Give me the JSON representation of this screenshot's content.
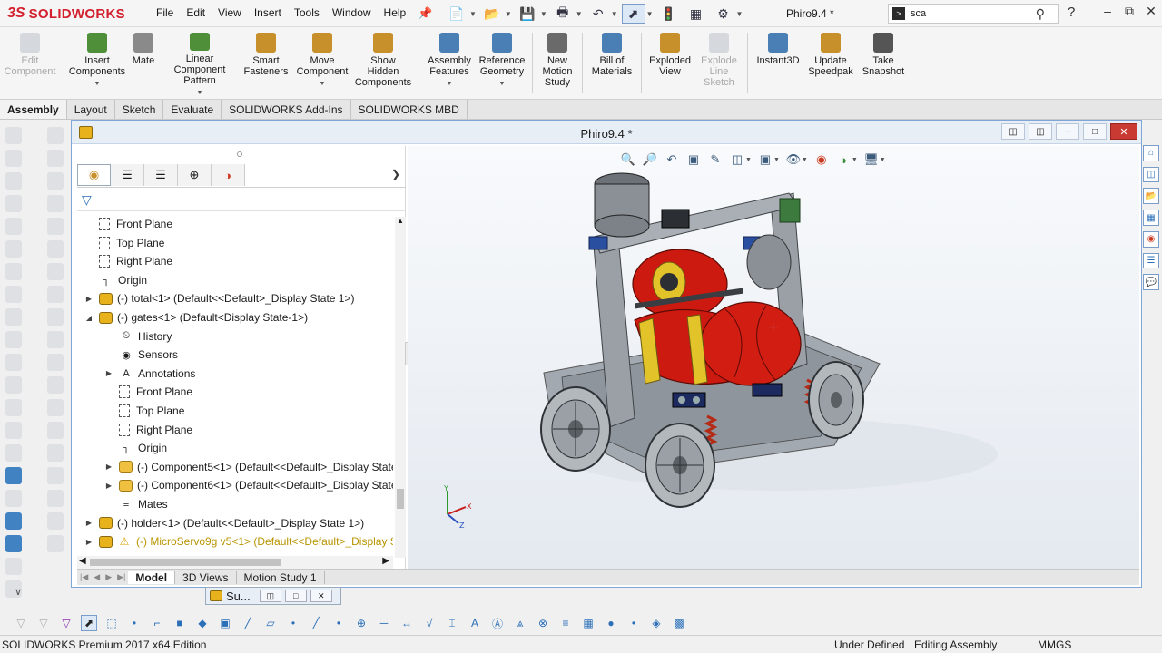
{
  "app": {
    "logo_text": "SOLIDWORKS",
    "logo_mark": "3S"
  },
  "menu": [
    "File",
    "Edit",
    "View",
    "Insert",
    "Tools",
    "Window",
    "Help"
  ],
  "title_bar": {
    "document_title": "Phiro9.4 *"
  },
  "search": {
    "value": "sca"
  },
  "ribbon": [
    {
      "label": "Edit Component",
      "lines": [
        "Edit",
        "Component"
      ],
      "enabled": false,
      "icon": "edit-component-icon",
      "color": "#9aa7b4"
    },
    {
      "label": "Insert Components",
      "lines": [
        "Insert",
        "Components"
      ],
      "enabled": true,
      "dropdown": true,
      "icon": "insert-components-icon",
      "color": "#4f8f3a"
    },
    {
      "label": "Mate",
      "lines": [
        "Mate"
      ],
      "enabled": true,
      "icon": "mate-icon",
      "color": "#8a8a8a"
    },
    {
      "label": "Linear Component Pattern",
      "lines": [
        "Linear Component",
        "Pattern"
      ],
      "enabled": true,
      "dropdown": true,
      "icon": "linear-pattern-icon",
      "color": "#4f8f3a"
    },
    {
      "label": "Smart Fasteners",
      "lines": [
        "Smart",
        "Fasteners"
      ],
      "enabled": true,
      "icon": "smart-fasteners-icon",
      "color": "#c7902a"
    },
    {
      "label": "Move Component",
      "lines": [
        "Move",
        "Component"
      ],
      "enabled": true,
      "dropdown": true,
      "icon": "move-component-icon",
      "color": "#c7902a"
    },
    {
      "label": "Show Hidden Components",
      "lines": [
        "Show",
        "Hidden",
        "Components"
      ],
      "enabled": true,
      "icon": "show-hidden-icon",
      "color": "#c7902a"
    },
    {
      "label": "Assembly Features",
      "lines": [
        "Assembly",
        "Features"
      ],
      "enabled": true,
      "dropdown": true,
      "icon": "assembly-features-icon",
      "color": "#4a7fb5"
    },
    {
      "label": "Reference Geometry",
      "lines": [
        "Reference",
        "Geometry"
      ],
      "enabled": true,
      "dropdown": true,
      "icon": "reference-geometry-icon",
      "color": "#4a7fb5"
    },
    {
      "label": "New Motion Study",
      "lines": [
        "New",
        "Motion",
        "Study"
      ],
      "enabled": true,
      "icon": "motion-study-icon",
      "color": "#6a6a6a"
    },
    {
      "label": "Bill of Materials",
      "lines": [
        "Bill of",
        "Materials"
      ],
      "enabled": true,
      "icon": "bom-icon",
      "color": "#4a7fb5"
    },
    {
      "label": "Exploded View",
      "lines": [
        "Exploded",
        "View"
      ],
      "enabled": true,
      "icon": "exploded-view-icon",
      "color": "#c7902a"
    },
    {
      "label": "Explode Line Sketch",
      "lines": [
        "Explode",
        "Line",
        "Sketch"
      ],
      "enabled": false,
      "icon": "explode-line-icon",
      "color": "#9aa7b4"
    },
    {
      "label": "Instant3D",
      "lines": [
        "Instant3D"
      ],
      "enabled": true,
      "icon": "instant3d-icon",
      "color": "#4a7fb5"
    },
    {
      "label": "Update Speedpak",
      "lines": [
        "Update",
        "Speedpak"
      ],
      "enabled": true,
      "icon": "speedpak-icon",
      "color": "#c7902a"
    },
    {
      "label": "Take Snapshot",
      "lines": [
        "Take",
        "Snapshot"
      ],
      "enabled": true,
      "icon": "snapshot-icon",
      "color": "#555555"
    }
  ],
  "command_tabs": [
    "Assembly",
    "Layout",
    "Sketch",
    "Evaluate",
    "SOLIDWORKS Add-Ins",
    "SOLIDWORKS MBD"
  ],
  "active_command_tab": "Assembly",
  "document_window": {
    "title": "Phiro9.4 *"
  },
  "tree": [
    {
      "label": "Front Plane",
      "indent": 1,
      "icon": "plane-icon",
      "expander": ""
    },
    {
      "label": "Top Plane",
      "indent": 1,
      "icon": "plane-icon",
      "expander": ""
    },
    {
      "label": "Right Plane",
      "indent": 1,
      "icon": "plane-icon",
      "expander": ""
    },
    {
      "label": "Origin",
      "indent": 1,
      "icon": "origin-icon",
      "expander": ""
    },
    {
      "label": "(-) total<1> (Default<<Default>_Display State 1>)",
      "indent": 1,
      "icon": "assembly-icon",
      "expander": "collapsed"
    },
    {
      "label": "(-) gates<1> (Default<Display State-1>)",
      "indent": 1,
      "icon": "assembly-icon",
      "expander": "expanded"
    },
    {
      "label": "History",
      "indent": 2,
      "icon": "history-icon",
      "expander": ""
    },
    {
      "label": "Sensors",
      "indent": 2,
      "icon": "sensors-icon",
      "expander": ""
    },
    {
      "label": "Annotations",
      "indent": 2,
      "icon": "annotations-icon",
      "expander": "collapsed"
    },
    {
      "label": "Front Plane",
      "indent": 2,
      "icon": "plane-icon",
      "expander": ""
    },
    {
      "label": "Top Plane",
      "indent": 2,
      "icon": "plane-icon",
      "expander": ""
    },
    {
      "label": "Right Plane",
      "indent": 2,
      "icon": "plane-icon",
      "expander": ""
    },
    {
      "label": "Origin",
      "indent": 2,
      "icon": "origin-icon",
      "expander": ""
    },
    {
      "label": "(-) Component5<1> (Default<<Default>_Display State",
      "indent": 2,
      "icon": "assembly-icon",
      "expander": "collapsed"
    },
    {
      "label": "(-) Component6<1> (Default<<Default>_Display State",
      "indent": 2,
      "icon": "assembly-icon",
      "expander": "collapsed"
    },
    {
      "label": "Mates",
      "indent": 2,
      "icon": "mates-icon",
      "expander": ""
    },
    {
      "label": "(-) holder<1> (Default<<Default>_Display State 1>)",
      "indent": 1,
      "icon": "assembly-icon",
      "expander": "collapsed"
    },
    {
      "label": "(-) MicroServo9g v5<1> (Default<<Default>_Display S",
      "indent": 1,
      "icon": "warning-icon",
      "expander": "collapsed",
      "status": "warning"
    }
  ],
  "bottom_tabs": [
    "Model",
    "3D Views",
    "Motion Study 1"
  ],
  "active_bottom_tab": "Model",
  "minimized_window": {
    "label": "Su..."
  },
  "status_bar": {
    "edition": "SOLIDWORKS Premium 2017 x64 Edition",
    "definition": "Under Defined",
    "mode": "Editing Assembly",
    "units": "MMGS"
  },
  "colors": {
    "brand_red": "#d2202e",
    "accent_blue": "#2a6fb8",
    "selection_blue": "#dce8f6",
    "model_red": "#cc1a10",
    "model_gray": "#9aa0a6",
    "model_yellow": "#e2c42a"
  }
}
